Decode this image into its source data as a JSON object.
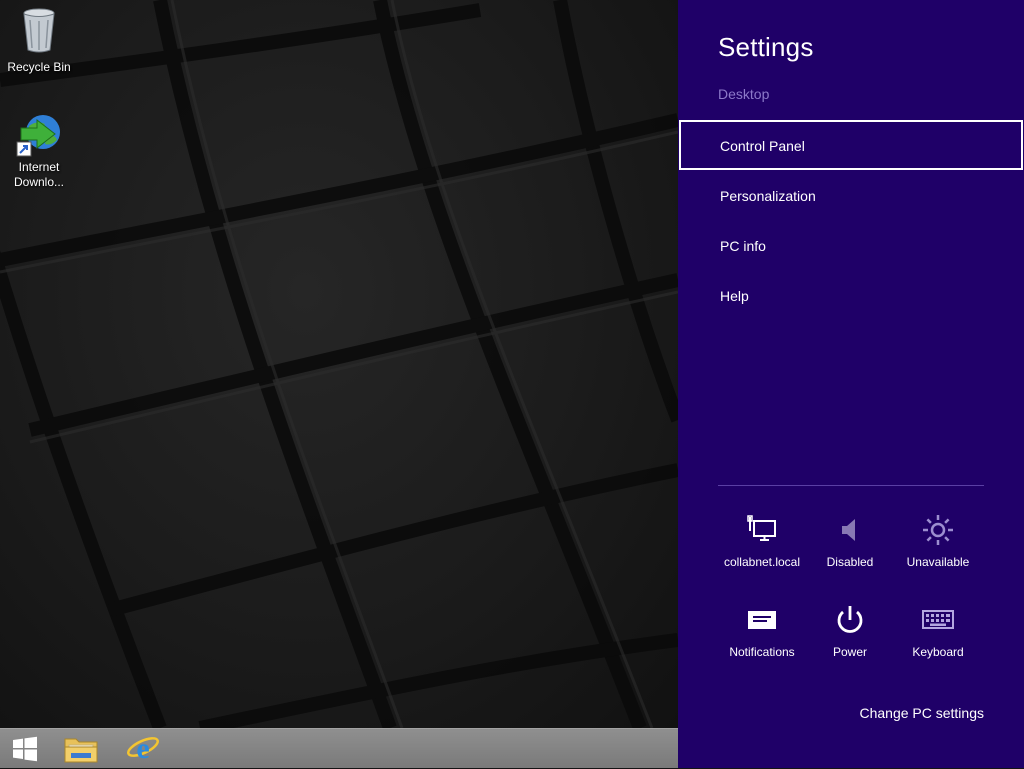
{
  "desktop": {
    "icons": [
      {
        "label": "Recycle Bin",
        "icon": "recycle-bin-icon"
      },
      {
        "label": "Internet\nDownlo...",
        "icon": "internet-download-manager-icon"
      }
    ]
  },
  "taskbar": {
    "items": [
      {
        "icon": "windows-start-icon"
      },
      {
        "icon": "file-explorer-icon"
      },
      {
        "icon": "internet-explorer-icon"
      }
    ]
  },
  "settings_charm": {
    "title": "Settings",
    "context": "Desktop",
    "menu": [
      {
        "label": "Control Panel",
        "selected": true
      },
      {
        "label": "Personalization",
        "selected": false
      },
      {
        "label": "PC info",
        "selected": false
      },
      {
        "label": "Help",
        "selected": false
      }
    ],
    "tiles": [
      {
        "label": "collabnet.local",
        "icon": "network-icon"
      },
      {
        "label": "Disabled",
        "icon": "volume-icon"
      },
      {
        "label": "Unavailable",
        "icon": "brightness-icon"
      },
      {
        "label": "Notifications",
        "icon": "notifications-icon"
      },
      {
        "label": "Power",
        "icon": "power-icon"
      },
      {
        "label": "Keyboard",
        "icon": "keyboard-icon"
      }
    ],
    "change_pc_settings": "Change PC settings"
  },
  "colors": {
    "charm_background": "#1f0068",
    "charm_subtext": "#8c79c9",
    "taskbar": "#858585"
  }
}
